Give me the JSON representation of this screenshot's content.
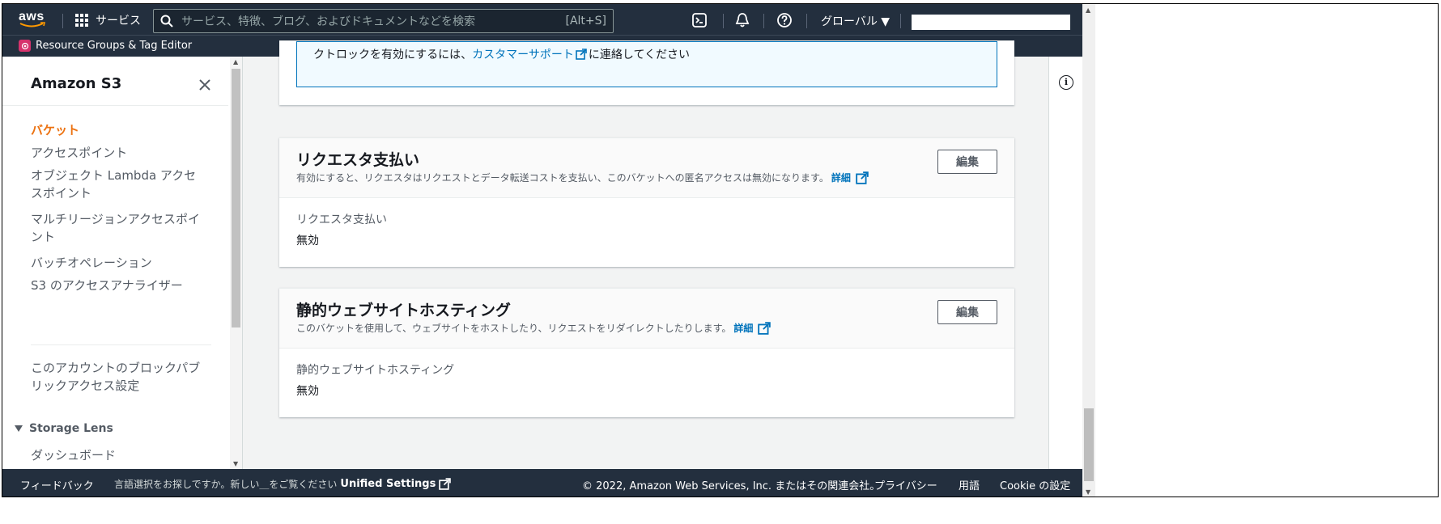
{
  "topnav": {
    "logo_text": "aws",
    "services_label": "サービス",
    "search_placeholder": "サービス、特徴、ブログ、およびドキュメントなどを検索",
    "search_shortcut": "[Alt+S]",
    "region_label": "グローバル ▼",
    "icons": [
      "cloudshell-icon",
      "bell-icon",
      "help-icon"
    ]
  },
  "subnav": {
    "resource_groups_label": "Resource Groups & Tag Editor"
  },
  "sidebar": {
    "title": "Amazon S3",
    "items": [
      {
        "label": "バケット",
        "active": true
      },
      {
        "label": "アクセスポイント"
      },
      {
        "label": "オブジェクト Lambda アクセスポイント"
      },
      {
        "label": "マルチリージョンアクセスポイント"
      },
      {
        "label": "バッチオペレーション"
      },
      {
        "label": "S3 のアクセスアナライザー"
      }
    ],
    "block_public_access": "このアカウントのブロックパブリックアクセス設定",
    "storage_lens_header": "Storage Lens",
    "storage_lens_items": [
      {
        "label": "ダッシュボード"
      }
    ]
  },
  "main": {
    "alert_text_prefix": "クトロックを有効にするには、",
    "alert_link": "カスタマーサポート",
    "alert_text_suffix": "に連絡してください",
    "requester_pays": {
      "title": "リクエスタ支払い",
      "description": "有効にすると、リクエスタはリクエストとデータ転送コストを支払い、このバケットへの匿名アクセスは無効になります。",
      "info_link": "詳細",
      "edit_label": "編集",
      "field_label": "リクエスタ支払い",
      "field_value": "無効"
    },
    "static_hosting": {
      "title": "静的ウェブサイトホスティング",
      "description": "このバケットを使用して、ウェブサイトをホストしたり、リクエストをリダイレクトしたりします。",
      "info_link": "詳細",
      "edit_label": "編集",
      "field_label": "静的ウェブサイトホスティング",
      "field_value": "無効"
    }
  },
  "footer": {
    "feedback": "フィードバック",
    "language_text": "言語選択をお探しですか。新しい＿をご覧ください",
    "unified_settings": "Unified Settings",
    "copyright": "© 2022, Amazon Web Services, Inc. またはその関連会社。",
    "privacy": "プライバシー",
    "terms": "用語",
    "cookie": "Cookie の設定"
  },
  "colors": {
    "nav_bg": "#232f3e",
    "accent_orange": "#ec7211",
    "link_blue": "#0073bb"
  }
}
